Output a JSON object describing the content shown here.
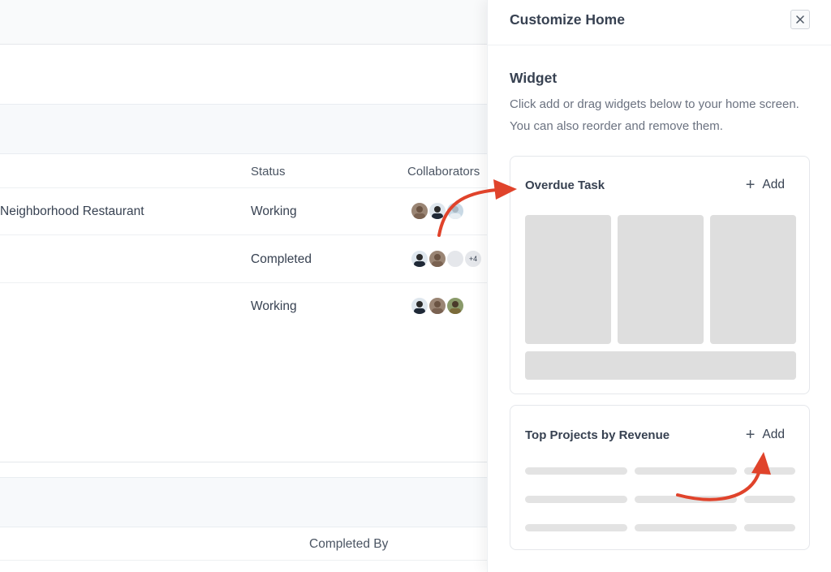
{
  "table": {
    "headers": {
      "status": "Status",
      "collaborators": "Collaborators"
    },
    "rows": [
      {
        "project": "Neighborhood Restaurant",
        "status": "Working",
        "collaborators": [
          "avatar",
          "avatar",
          "avatar"
        ],
        "extra": ""
      },
      {
        "project": "",
        "status": "Completed",
        "collaborators": [
          "avatar",
          "avatar",
          "blank"
        ],
        "extra": "+4"
      },
      {
        "project": "",
        "status": "Working",
        "collaborators": [
          "avatar",
          "avatar",
          "avatar"
        ],
        "extra": ""
      }
    ],
    "second_header": "Completed By"
  },
  "panel": {
    "title": "Customize Home",
    "close_icon": "close-icon",
    "section_title": "Widget",
    "section_description": "Click add or drag widgets below to your home screen. You can also reorder and remove them.",
    "widgets": [
      {
        "title": "Overdue Task",
        "add_label": "Add",
        "add_icon": "plus-icon"
      },
      {
        "title": "Top Projects by Revenue",
        "add_label": "Add",
        "add_icon": "plus-icon"
      }
    ]
  },
  "colors": {
    "annotation_arrow": "#e0432b",
    "skeleton": "#dedede",
    "panel_bg": "#ffffff"
  }
}
